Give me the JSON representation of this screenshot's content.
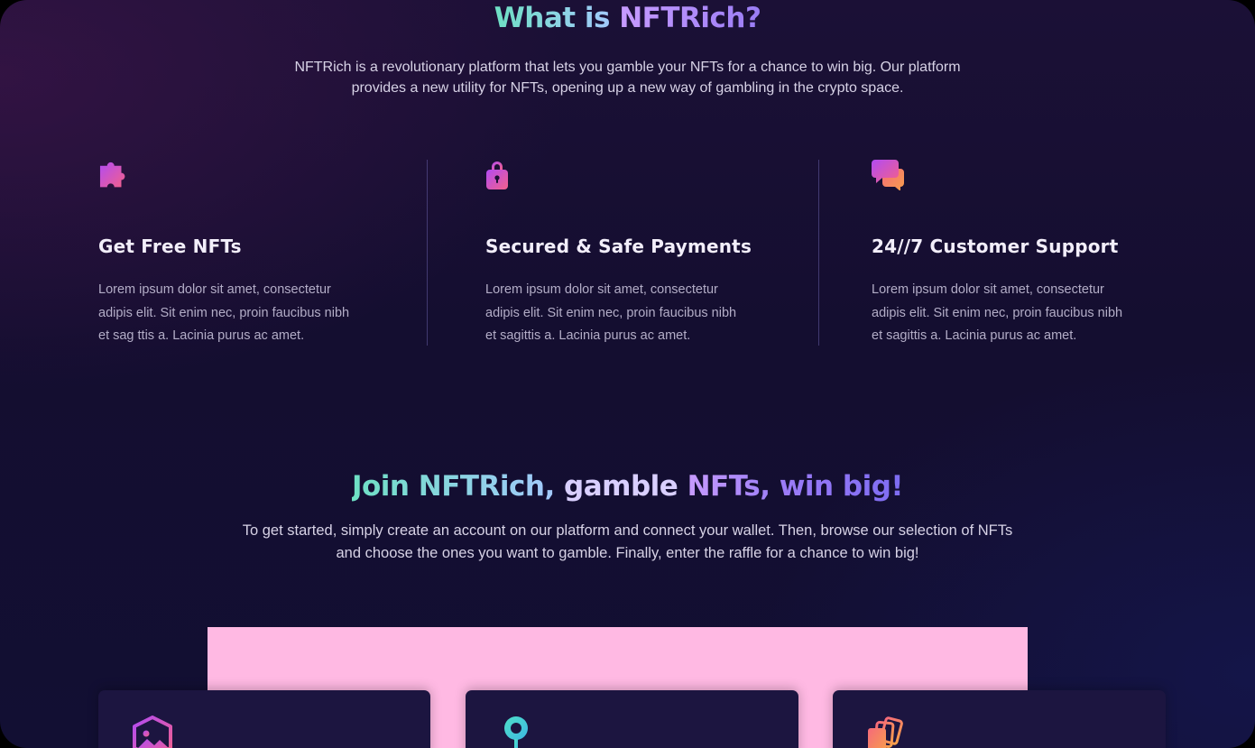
{
  "about": {
    "title_part1": "What is ",
    "title_part2": "NFTRich?",
    "description_line1": "NFTRich is a revolutionary platform that lets you gamble your NFTs for a chance to win big. Our platform",
    "description_line2": "provides a new utility for NFTs, opening up a new way of gambling in the crypto space."
  },
  "features": [
    {
      "icon": "puzzle-icon",
      "title": "Get Free NFTs",
      "text_line1": "Lorem ipsum dolor sit amet, consectetur",
      "text_line2": "adipis elit. Sit enim nec, proin faucibus nibh",
      "text_line3": "et sag ttis a. Lacinia purus ac amet."
    },
    {
      "icon": "lock-icon",
      "title": "Secured & Safe Payments",
      "text_line1": "Lorem ipsum dolor sit amet, consectetur",
      "text_line2": "adipis elit. Sit enim nec, proin faucibus nibh",
      "text_line3": "et sagittis a. Lacinia purus ac amet."
    },
    {
      "icon": "chat-bubbles-icon",
      "title": "24//7 Customer Support",
      "text_line1": "Lorem ipsum dolor sit amet, consectetur",
      "text_line2": "adipis elit. Sit enim nec, proin faucibus nibh",
      "text_line3": "et sagittis a. Lacinia purus ac amet."
    }
  ],
  "join": {
    "title_part1": "Join NFTRich, ",
    "title_part2": "gamble ",
    "title_part3": "NFTs, ",
    "title_part4": "win big!",
    "description_line1": "To get started, simply create an account on our platform and connect your wallet. Then, browse our selection of NFTs",
    "description_line2": "and choose the ones you want to gamble. Finally, enter the raffle for a chance to win big!"
  },
  "cards": [
    {
      "icon": "image-icon"
    },
    {
      "icon": "location-pin-icon"
    },
    {
      "icon": "cards-icon"
    }
  ],
  "colors": {
    "accent_teal": "#6ee0c4",
    "accent_purple": "#c79bff",
    "accent_blue": "#7d6cf2",
    "panel_pink": "#ffb9e3",
    "card_bg": "#1c1540",
    "icon_gradient_start": "#b24bf3",
    "icon_gradient_end": "#f3608a"
  }
}
